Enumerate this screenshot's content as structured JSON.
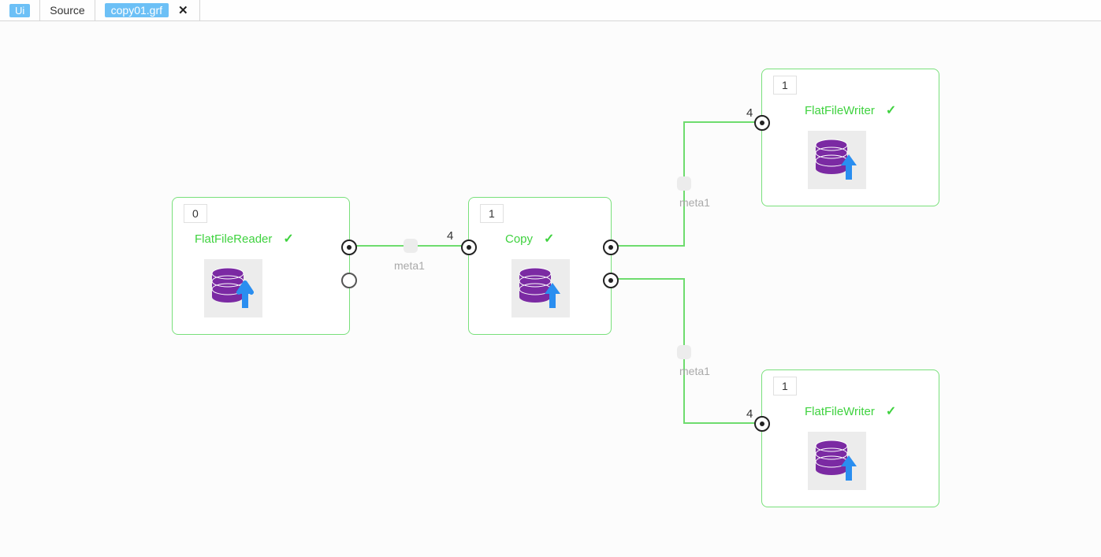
{
  "topbar": {
    "ui_badge": "Ui",
    "source_label": "Source",
    "active_tab": "copy01.grf"
  },
  "nodes": {
    "reader": {
      "badge": "0",
      "title": "FlatFileReader",
      "icon": "database-upload-icon"
    },
    "copy": {
      "badge": "1",
      "title": "Copy",
      "icon": "database-upload-icon"
    },
    "writer1": {
      "badge": "1",
      "title": "FlatFileWriter",
      "icon": "database-upload-icon"
    },
    "writer2": {
      "badge": "1",
      "title": "FlatFileWriter",
      "icon": "database-upload-icon"
    }
  },
  "edges": {
    "e1": {
      "count": "4",
      "meta": "meta1"
    },
    "e2": {
      "count": "4",
      "meta": "meta1"
    },
    "e3": {
      "count": "4",
      "meta": "meta1"
    }
  }
}
